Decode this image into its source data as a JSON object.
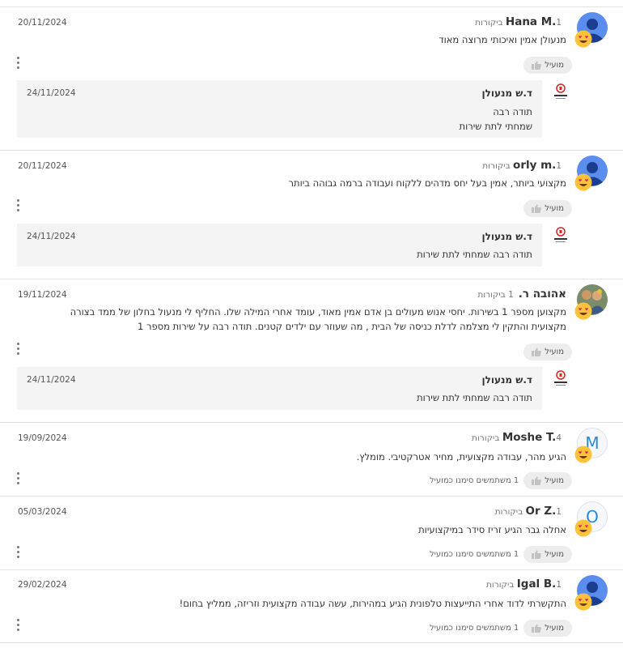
{
  "helpful_label": "מועיל",
  "reviews": [
    {
      "name": "Hana M.",
      "count": "1 ביקורות",
      "date": "20/11/2024",
      "lines": [
        "מנעולן אמין ואיכותי מרוצה מאוד"
      ],
      "helpful_count": "",
      "avatar": "google-avatar-icon",
      "reply": {
        "name": "ד.ש מנעולן",
        "date": "24/11/2024",
        "lines": [
          "תודה רבה",
          "שמחתי לתת שירות"
        ]
      }
    },
    {
      "name": "orly m.",
      "count": "1 ביקורות",
      "date": "20/11/2024",
      "lines": [
        "מקצועי ביותר, אמין בעל יחס מדהים ללקוח ועבודה ברמה גבוהה ביותר"
      ],
      "helpful_count": "",
      "avatar": "google-avatar-icon",
      "reply": {
        "name": "ד.ש מנעולן",
        "date": "24/11/2024",
        "lines": [
          "תודה רבה שמחתי לתת שירות"
        ]
      }
    },
    {
      "name": "אהובה ר.",
      "count": "1 ביקורות",
      "date": "19/11/2024",
      "lines": [
        "מקצוען מספר 1 בשירות. יחסי אנוש מעולים בן אדם אמין מאוד, עומד אחרי המילה שלו. החליף לי מנעול בחלון של ממד בצורה",
        "מקצועית והתקין לי מצלמה לדלת כניסה של הבית , מה שעוזר עם ילדים קטנים. תודה רבה על שירות מספר 1"
      ],
      "helpful_count": "",
      "avatar": "photo-avatar",
      "reply": {
        "name": "ד.ש מנעולן",
        "date": "24/11/2024",
        "lines": [
          "תודה רבה שמחתי לתת שירות"
        ]
      }
    },
    {
      "name": "Moshe T.",
      "count": "4 ביקורות",
      "date": "19/09/2024",
      "lines": [
        "הגיע מהר, עבודה מקצועית, מחיר אטרקטיבי. מומלץ."
      ],
      "helpful_count": "1 משתמשים סימנו כמועיל",
      "avatar": "letter-M",
      "reply": null
    },
    {
      "name": "Or Z.",
      "count": "1 ביקורות",
      "date": "05/03/2024",
      "lines": [
        "אחלה גבר הגיע זריז סידר במיקצועיות"
      ],
      "helpful_count": "1 משתמשים סימנו כמועיל",
      "avatar": "letter-O",
      "reply": null
    },
    {
      "name": "Igal B.",
      "count": "1 ביקורות",
      "date": "29/02/2024",
      "lines": [
        "התקשרתי לדוד אחרי התייעצות טלפונית הגיע במהירות, עשה עבודה מקצועית וזריזה, ממליץ בחום!"
      ],
      "helpful_count": "1 משתמשים סימנו כמועיל",
      "avatar": "google-avatar-icon",
      "reply": null
    }
  ]
}
